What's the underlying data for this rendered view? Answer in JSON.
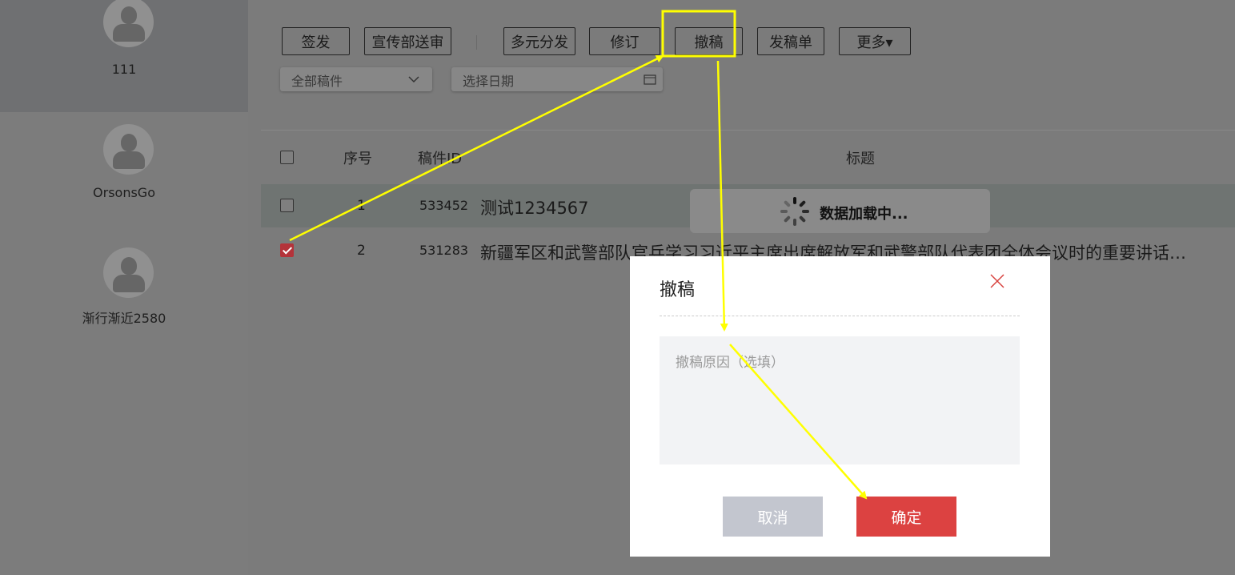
{
  "sidebar": {
    "users": [
      {
        "name": "111"
      },
      {
        "name": "OrsonsGo"
      },
      {
        "name": "渐行渐近2580"
      }
    ]
  },
  "toolbar": {
    "buttons": [
      {
        "label": "签发"
      },
      {
        "label": "宣传部送审"
      },
      {
        "label": "多元分发"
      },
      {
        "label": "修订"
      },
      {
        "label": "撤稿"
      },
      {
        "label": "发稿单"
      },
      {
        "label": "更多▾"
      }
    ]
  },
  "filters": {
    "scope_value": "全部稿件",
    "date_placeholder": "选择日期"
  },
  "table": {
    "headers": {
      "index": "序号",
      "id": "稿件ID",
      "title": "标题"
    },
    "rows": [
      {
        "index": "1",
        "id": "533452",
        "title": "测试1234567",
        "checked": false
      },
      {
        "index": "2",
        "id": "531283",
        "title": "新疆军区和武警部队官兵学习习近平主席出席解放军和武警部队代表团全体会议时的重要讲话…",
        "checked": true
      }
    ]
  },
  "loading": {
    "text": "数据加载中..."
  },
  "dialog": {
    "title": "撤稿",
    "reason_placeholder": "撤稿原因（选填）",
    "cancel_label": "取消",
    "confirm_label": "确定"
  },
  "colors": {
    "annotation": "#ffff00",
    "confirm": "#dc4241",
    "cancel": "#c3c6cf",
    "checkbox_checked": "#b4333a"
  }
}
